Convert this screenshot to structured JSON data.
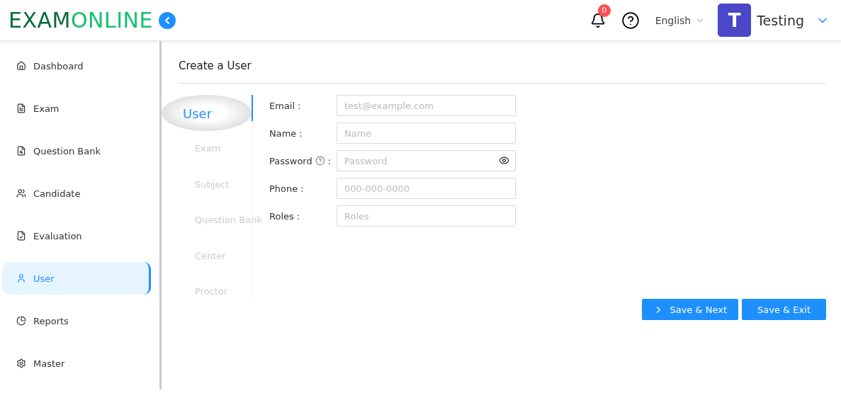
{
  "header": {
    "logo": [
      "EXAM",
      "ONLINE"
    ],
    "notification_count": "0",
    "language": "English",
    "avatar_letter": "T",
    "user_name": "Testing"
  },
  "sidebar": {
    "items": [
      {
        "label": "Dashboard",
        "selected": false
      },
      {
        "label": "Exam",
        "selected": false
      },
      {
        "label": "Question Bank",
        "selected": false
      },
      {
        "label": "Candidate",
        "selected": false
      },
      {
        "label": "Evaluation",
        "selected": false
      },
      {
        "label": "User",
        "selected": true
      },
      {
        "label": "Reports",
        "selected": false
      },
      {
        "label": "Master",
        "selected": false
      }
    ]
  },
  "page": {
    "title": "Create a User",
    "steps": [
      {
        "label": "User",
        "selected": true
      },
      {
        "label": "Exam",
        "selected": false
      },
      {
        "label": "Subject",
        "selected": false
      },
      {
        "label": "Question Bank",
        "selected": false
      },
      {
        "label": "Center",
        "selected": false
      },
      {
        "label": "Proctor",
        "selected": false
      }
    ],
    "fields": [
      {
        "label": "Email",
        "colon": ":",
        "placeholder": "test@example.com",
        "kind": "text"
      },
      {
        "label": "Name",
        "colon": ":",
        "placeholder": "Name",
        "kind": "text"
      },
      {
        "label": "Password",
        "colon": ":",
        "placeholder": "Password",
        "kind": "password"
      },
      {
        "label": "Phone",
        "colon": ":",
        "placeholder": "000-000-0000",
        "kind": "text"
      },
      {
        "label": "Roles",
        "colon": ":",
        "placeholder": "Roles",
        "kind": "text"
      }
    ],
    "buttons": [
      {
        "label": "Save & Next",
        "kind": "next"
      },
      {
        "label": "Save & Exit",
        "kind": "plain"
      }
    ]
  }
}
